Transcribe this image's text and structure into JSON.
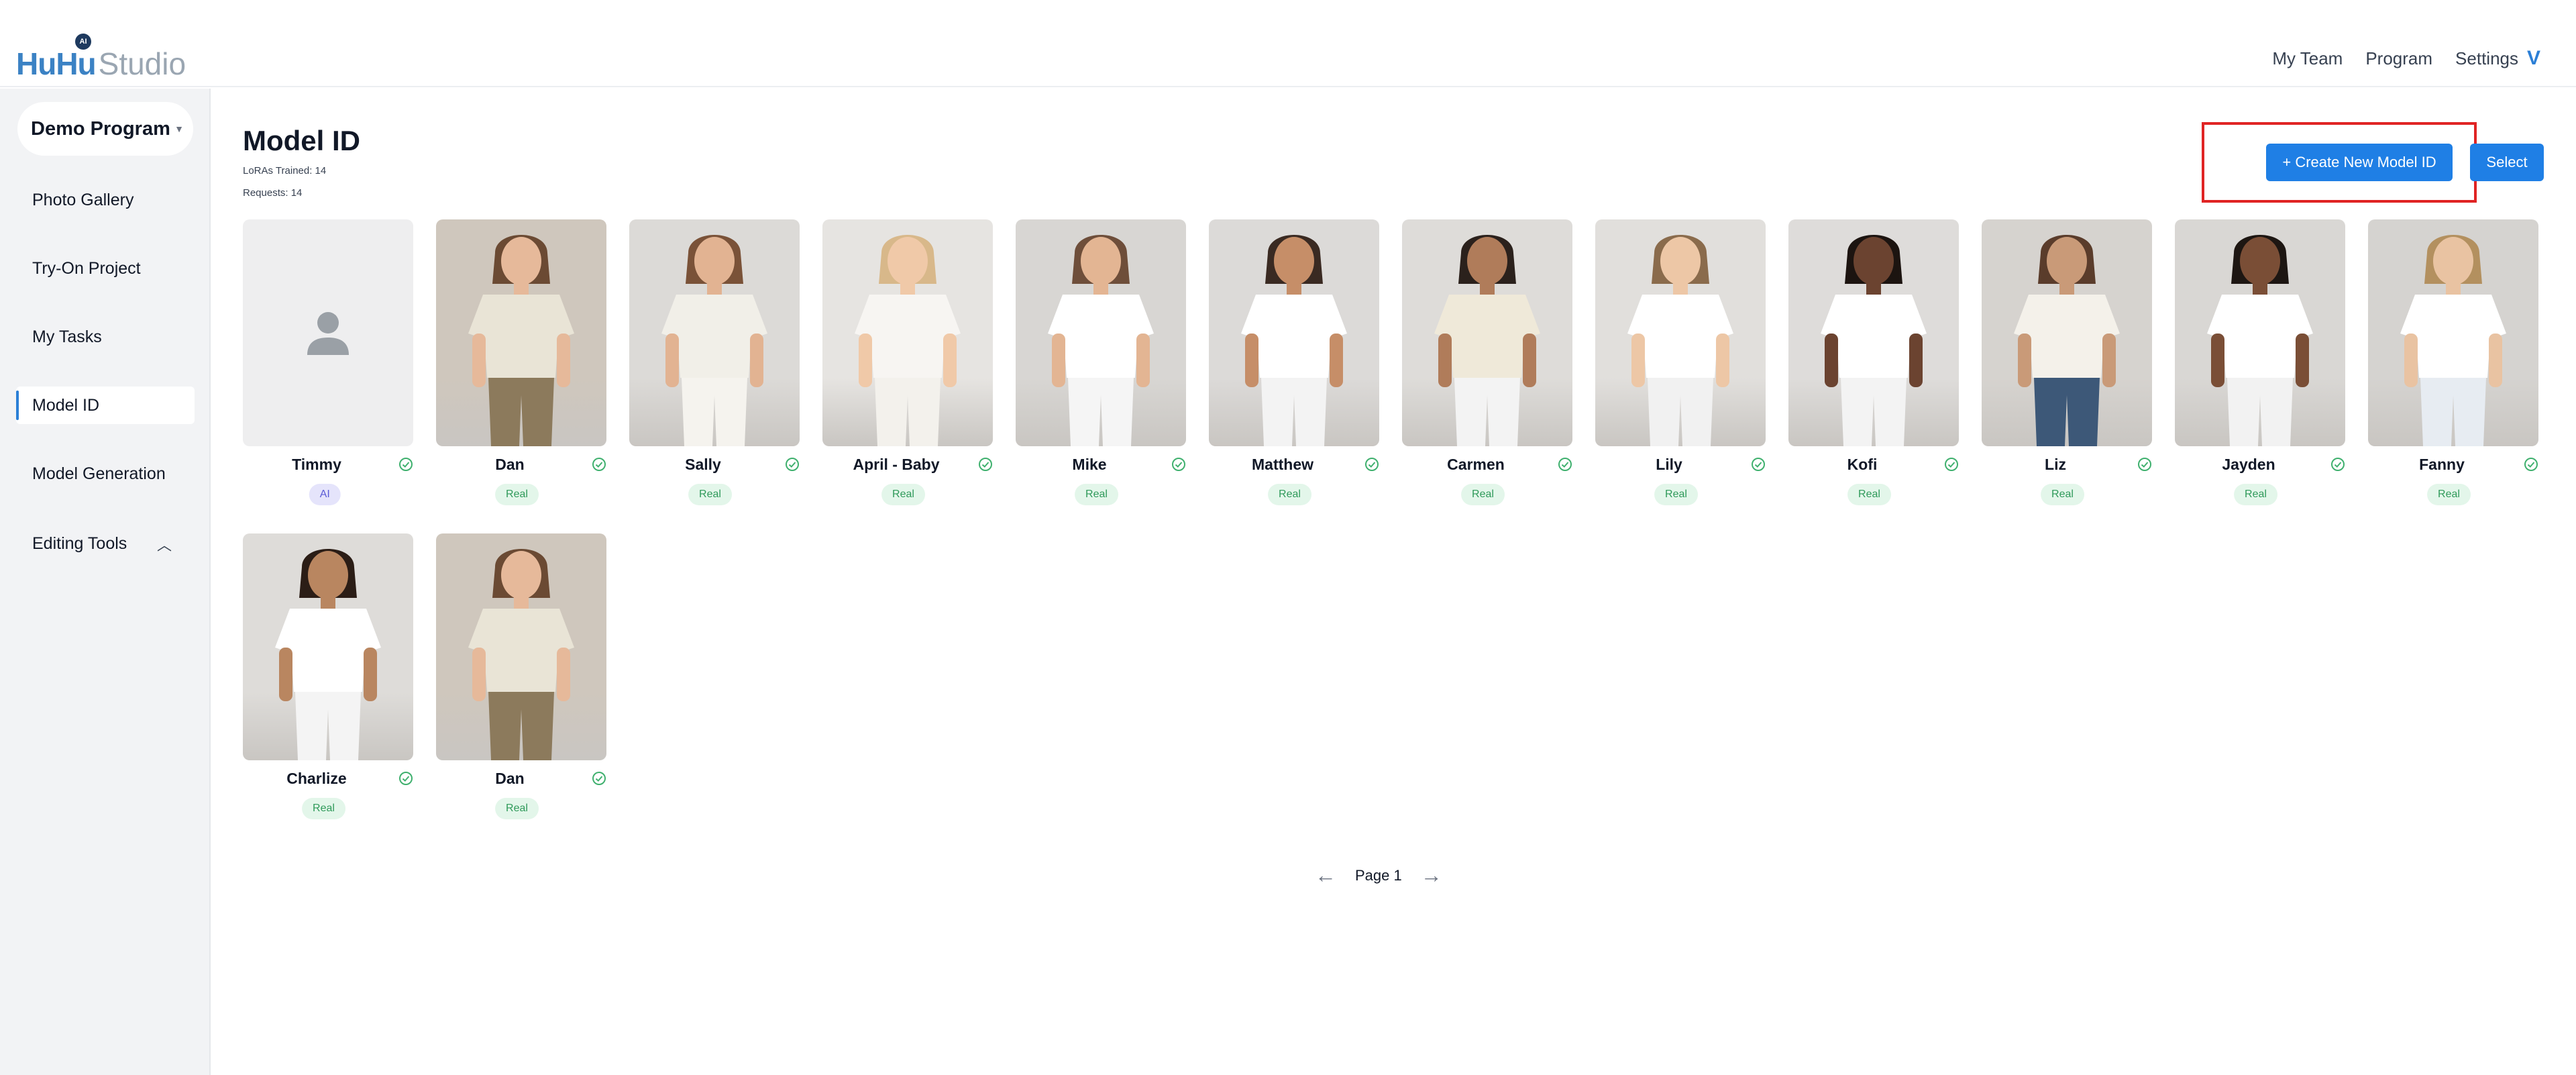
{
  "header": {
    "logo_huhu": "HuHu",
    "logo_badge": "AI",
    "logo_studio": "Studio",
    "nav": [
      "My Team",
      "Program",
      "Settings"
    ],
    "avatar": "V"
  },
  "sidebar": {
    "program": "Demo Program",
    "items": [
      {
        "label": "Photo Gallery"
      },
      {
        "label": "Try-On Project"
      },
      {
        "label": "My Tasks"
      },
      {
        "label": "Model ID",
        "active": true
      },
      {
        "label": "Model Generation"
      },
      {
        "label": "Editing Tools",
        "expandable": true
      }
    ]
  },
  "main": {
    "title": "Model ID",
    "loras": "LoRAs Trained: 14",
    "requests": "Requests: 14",
    "create_button": "+ Create New Model ID",
    "select_button": "Select",
    "models": [
      {
        "name": "Timmy",
        "tag": "AI"
      },
      {
        "name": "Dan",
        "tag": "Real"
      },
      {
        "name": "Sally",
        "tag": "Real"
      },
      {
        "name": "April - Baby",
        "tag": "Real"
      },
      {
        "name": "Mike",
        "tag": "Real"
      },
      {
        "name": "Matthew",
        "tag": "Real"
      },
      {
        "name": "Carmen",
        "tag": "Real"
      },
      {
        "name": "Lily",
        "tag": "Real"
      },
      {
        "name": "Kofi",
        "tag": "Real"
      },
      {
        "name": "Liz",
        "tag": "Real"
      },
      {
        "name": "Jayden",
        "tag": "Real"
      },
      {
        "name": "Fanny",
        "tag": "Real"
      },
      {
        "name": "Charlize",
        "tag": "Real"
      },
      {
        "name": "Dan",
        "tag": "Real"
      }
    ],
    "pagination": {
      "label": "Page 1"
    }
  },
  "colors": {
    "accent": "#1f7fe5",
    "highlight": "#e02424",
    "real_tag": "#e3f6ea",
    "ai_tag": "#e5e4fb"
  }
}
